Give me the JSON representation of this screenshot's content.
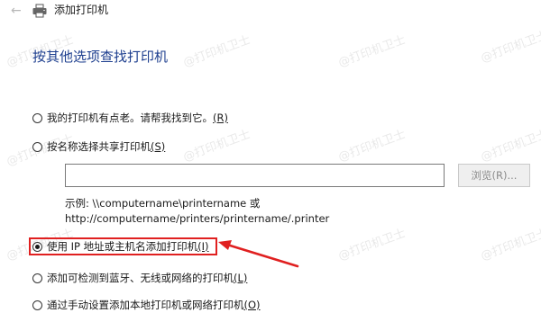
{
  "window": {
    "title": "添加打印机",
    "back_icon": "back-arrow-icon",
    "printer_icon": "printer-icon"
  },
  "heading": "按其他选项查找打印机",
  "options": [
    {
      "label": "我的打印机有点老。请帮我找到它。",
      "key": "(R)",
      "checked": false
    },
    {
      "label": "按名称选择共享打印机",
      "key": "(S)",
      "checked": false
    },
    {
      "label": "使用 IP 地址或主机名添加打印机",
      "key": "(I)",
      "checked": true
    },
    {
      "label": "添加可检测到蓝牙、无线或网络的打印机",
      "key": "(L)",
      "checked": false
    },
    {
      "label": "通过手动设置添加本地打印机或网络打印机",
      "key": "(O)",
      "checked": false
    }
  ],
  "shared_printer": {
    "input_value": "",
    "browse_label": "浏览(R)..."
  },
  "example": {
    "line1": "示例: \\\\computername\\printername 或",
    "line2": "http://computername/printers/printername/.printer"
  },
  "watermark": "@打印机卫士",
  "colors": {
    "heading": "#1e3f8f",
    "highlight": "#e02020",
    "button_disabled_text": "#8b8b8b"
  }
}
